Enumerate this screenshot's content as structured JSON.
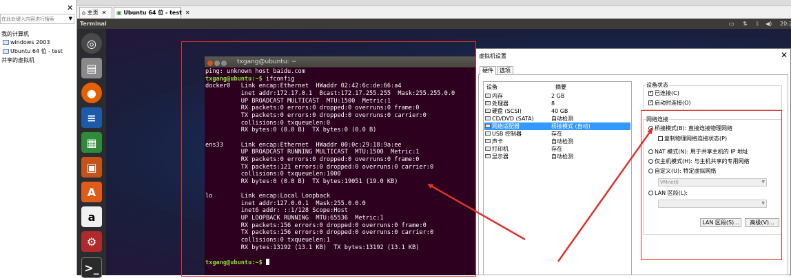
{
  "library": {
    "search_placeholder": "在此处键入内容进行搜索",
    "tree": [
      "我的计算机",
      "windows 2003",
      "Ubuntu 64 位 - test",
      "共享的虚拟机"
    ]
  },
  "tabs": [
    {
      "label": "主页"
    },
    {
      "label": "Ubuntu 64 位 - test"
    }
  ],
  "ubuntu": {
    "panel_title": "Terminal",
    "clock": "20:2"
  },
  "terminal": {
    "title": "txgang@ubuntu: ~",
    "prompt": "txgang@ubuntu:~$",
    "lines": [
      "ping: unknown host baidu.com",
      "",
      "docker0   Link encap:Ethernet  HWaddr 02:42:6c:de:66:a4",
      "          inet addr:172.17.0.1  Bcast:172.17.255.255  Mask:255.255.0.0",
      "          UP BROADCAST MULTICAST  MTU:1500  Metric:1",
      "          RX packets:0 errors:0 dropped:0 overruns:0 frame:0",
      "          TX packets:0 errors:0 dropped:0 overruns:0 carrier:0",
      "          collisions:0 txqueuelen:0",
      "          RX bytes:0 (0.0 B)  TX bytes:0 (0.0 B)",
      "",
      "ens33     Link encap:Ethernet  HWaddr 00:0c:29:18:9a:ee",
      "          UP BROADCAST RUNNING MULTICAST  MTU:1500  Metric:1",
      "          RX packets:0 errors:0 dropped:0 overruns:0 frame:0",
      "          TX packets:121 errors:0 dropped:0 overruns:0 carrier:0",
      "          collisions:0 txqueuelen:1000",
      "          RX bytes:0 (0.0 B)  TX bytes:19051 (19.0 KB)",
      "",
      "lo        Link encap:Local Loopback",
      "          inet addr:127.0.0.1  Mask:255.0.0.0",
      "          inet6 addr: ::1/128 Scope:Host",
      "          UP LOOPBACK RUNNING  MTU:65536  Metric:1",
      "          RX packets:156 errors:0 dropped:0 overruns:0 frame:0",
      "          TX packets:156 errors:0 dropped:0 overruns:0 carrier:0",
      "          collisions:0 txqueuelen:1",
      "          RX bytes:13192 (13.1 KB)  TX bytes:13192 (13.1 KB)",
      ""
    ],
    "command": " ifconfig"
  },
  "dialog": {
    "title": "虚拟机设置",
    "tabs": [
      "硬件",
      "选项"
    ],
    "col_device": "设备",
    "col_summary": "摘要",
    "devices": [
      {
        "name": "内存",
        "summary": "2 GB"
      },
      {
        "name": "处理器",
        "summary": "8"
      },
      {
        "name": "硬盘 (SCSI)",
        "summary": "40 GB"
      },
      {
        "name": "CD/DVD (SATA)",
        "summary": "自动检测"
      },
      {
        "name": "网络适配器",
        "summary": "桥接模式 (自动)"
      },
      {
        "name": "USB 控制器",
        "summary": "存在"
      },
      {
        "name": "声卡",
        "summary": "自动检测"
      },
      {
        "name": "打印机",
        "summary": "存在"
      },
      {
        "name": "显示器",
        "summary": "自动检测"
      }
    ],
    "device_status": {
      "label": "设备状态",
      "connected": "已连接(C)",
      "connect_on_power": "启动时连接(O)"
    },
    "network": {
      "label": "网络连接",
      "bridged": "桥接模式(B): 直接连接物理网络",
      "replicate": "复制物理网络连接状态(P)",
      "nat": "NAT 模式(N): 用于共享主机的 IP 地址",
      "host_only": "仅主机模式(H): 与主机共享的专用网络",
      "custom": "自定义(U): 特定虚拟网络",
      "custom_value": "VMnet0",
      "lan": "LAN 区段(L):",
      "lan_button": "LAN 区段(S)...",
      "advanced_button": "高级(V)..."
    }
  }
}
